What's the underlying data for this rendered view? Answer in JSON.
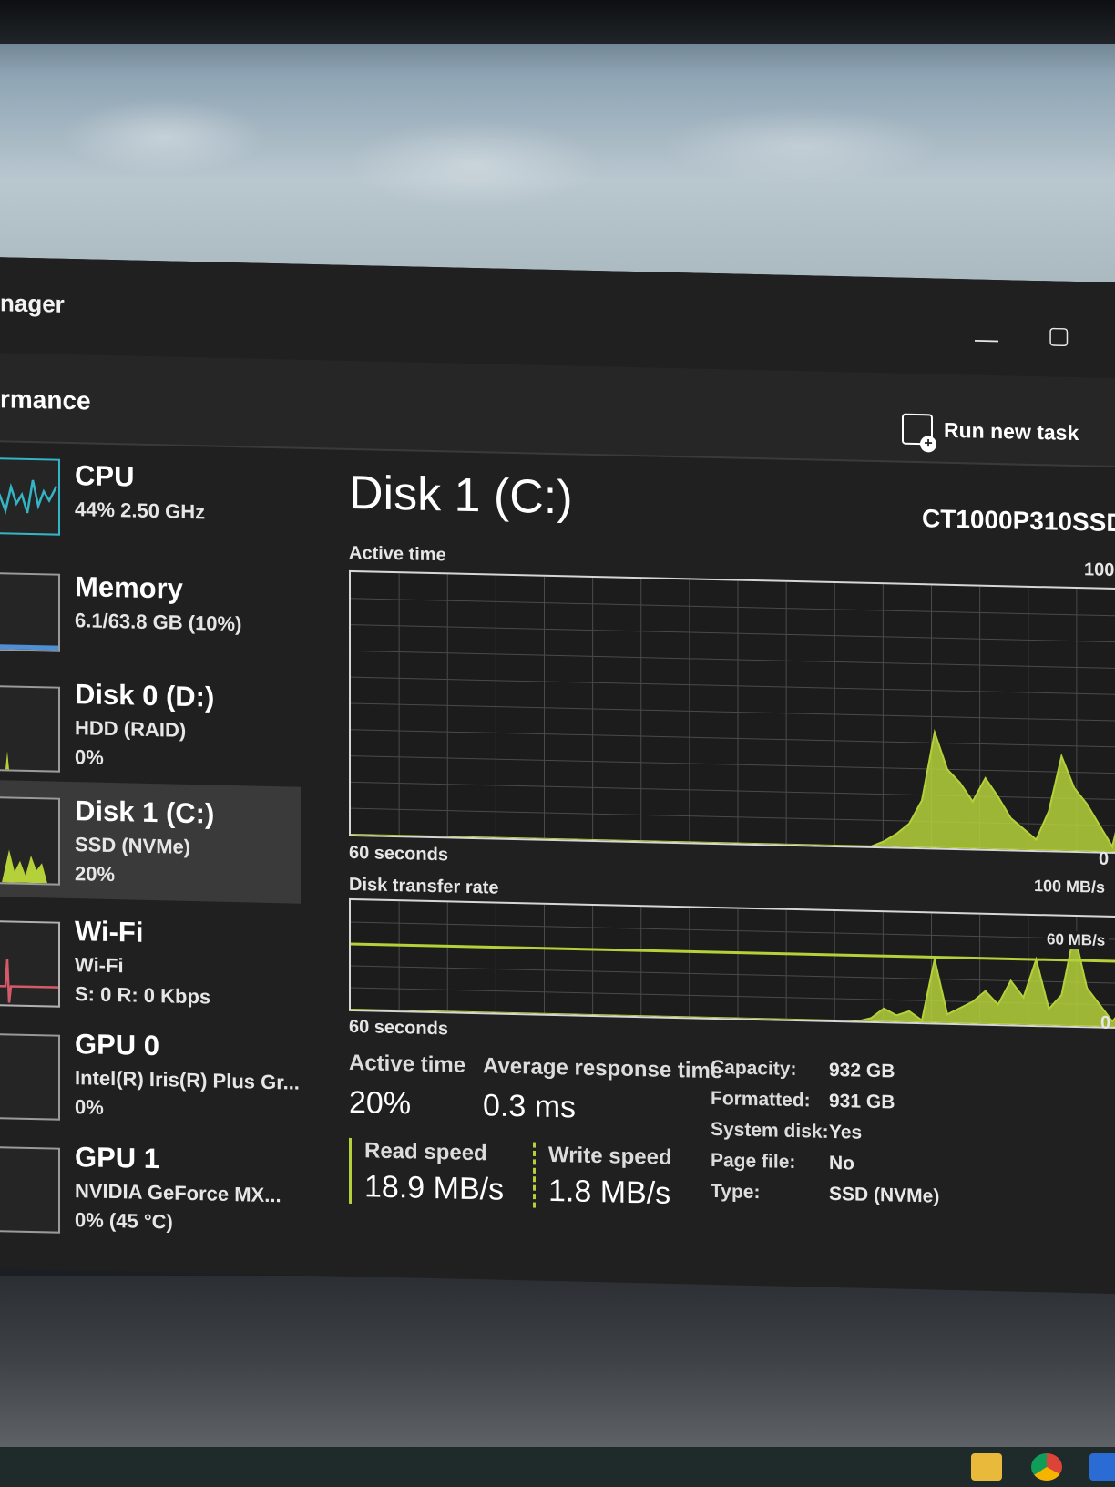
{
  "window": {
    "title": "nager",
    "minimize_icon": "minimize-icon",
    "maximize_icon": "maximize-icon"
  },
  "toolbar": {
    "section_title": "rmance",
    "run_new_task": "Run new task",
    "run_icon": "run-task-icon"
  },
  "sidebar": {
    "items": [
      {
        "name": "CPU",
        "line1": "44% 2.50 GHz",
        "line2": ""
      },
      {
        "name": "Memory",
        "line1": "6.1/63.8 GB (10%)",
        "line2": ""
      },
      {
        "name": "Disk 0 (D:)",
        "line1": "HDD (RAID)",
        "line2": "0%"
      },
      {
        "name": "Disk 1 (C:)",
        "line1": "SSD (NVMe)",
        "line2": "20%"
      },
      {
        "name": "Wi-Fi",
        "line1": "Wi-Fi",
        "line2": "S: 0 R: 0 Kbps"
      },
      {
        "name": "GPU 0",
        "line1": "Intel(R) Iris(R) Plus Gr...",
        "line2": "0%"
      },
      {
        "name": "GPU 1",
        "line1": "NVIDIA GeForce MX...",
        "line2": "0% (45 °C)"
      }
    ]
  },
  "colors": {
    "disk_accent": "#b5d13a",
    "cpu_accent": "#33b5c6",
    "wifi_accent": "#d45a6a",
    "memory_accent": "#4f8fd6"
  },
  "disk": {
    "title": "Disk 1 (C:)",
    "model": "CT1000P310SSD",
    "active_time_label": "Active time",
    "active_time_max": "100",
    "active_time_min": "0",
    "graph1_time": "60 seconds",
    "transfer_label": "Disk transfer rate",
    "transfer_max": "100 MB/s",
    "transfer_mid": "60 MB/s",
    "transfer_min": "0",
    "graph2_time": "60 seconds"
  },
  "chart_data": [
    {
      "type": "area",
      "title": "Active time",
      "ylim": [
        0,
        100
      ],
      "xlabel": "60 seconds",
      "values": [
        0,
        0,
        0,
        0,
        0,
        0,
        0,
        0,
        0,
        0,
        0,
        0,
        0,
        0,
        0,
        0,
        0,
        0,
        0,
        0,
        0,
        0,
        0,
        0,
        0,
        0,
        0,
        0,
        0,
        0,
        0,
        0,
        0,
        0,
        0,
        0,
        0,
        0,
        0,
        0,
        0,
        0,
        2,
        5,
        9,
        18,
        44,
        30,
        25,
        18,
        27,
        20,
        12,
        8,
        4,
        15,
        36,
        24,
        18,
        10,
        2,
        22
      ]
    },
    {
      "type": "area",
      "title": "Disk transfer rate",
      "ylim": [
        0,
        100
      ],
      "xlabel": "60 seconds",
      "values": [
        0,
        0,
        0,
        0,
        0,
        0,
        0,
        0,
        0,
        0,
        0,
        0,
        0,
        0,
        0,
        0,
        0,
        0,
        0,
        0,
        0,
        0,
        0,
        0,
        0,
        0,
        0,
        0,
        0,
        0,
        0,
        0,
        0,
        0,
        0,
        0,
        0,
        0,
        0,
        0,
        0,
        3,
        12,
        6,
        10,
        2,
        58,
        8,
        14,
        20,
        30,
        18,
        40,
        25,
        60,
        15,
        28,
        85,
        35,
        20,
        5,
        18
      ]
    }
  ],
  "stats": {
    "active_time_label": "Active time",
    "active_time_value": "20%",
    "avg_response_label": "Average response time",
    "avg_response_value": "0.3 ms",
    "read_label": "Read speed",
    "read_value": "18.9 MB/s",
    "write_label": "Write speed",
    "write_value": "1.8 MB/s"
  },
  "properties": [
    {
      "key": "Capacity:",
      "value": "932 GB"
    },
    {
      "key": "Formatted:",
      "value": "931 GB"
    },
    {
      "key": "System disk:",
      "value": "Yes"
    },
    {
      "key": "Page file:",
      "value": "No"
    },
    {
      "key": "Type:",
      "value": "SSD (NVMe)"
    }
  ]
}
